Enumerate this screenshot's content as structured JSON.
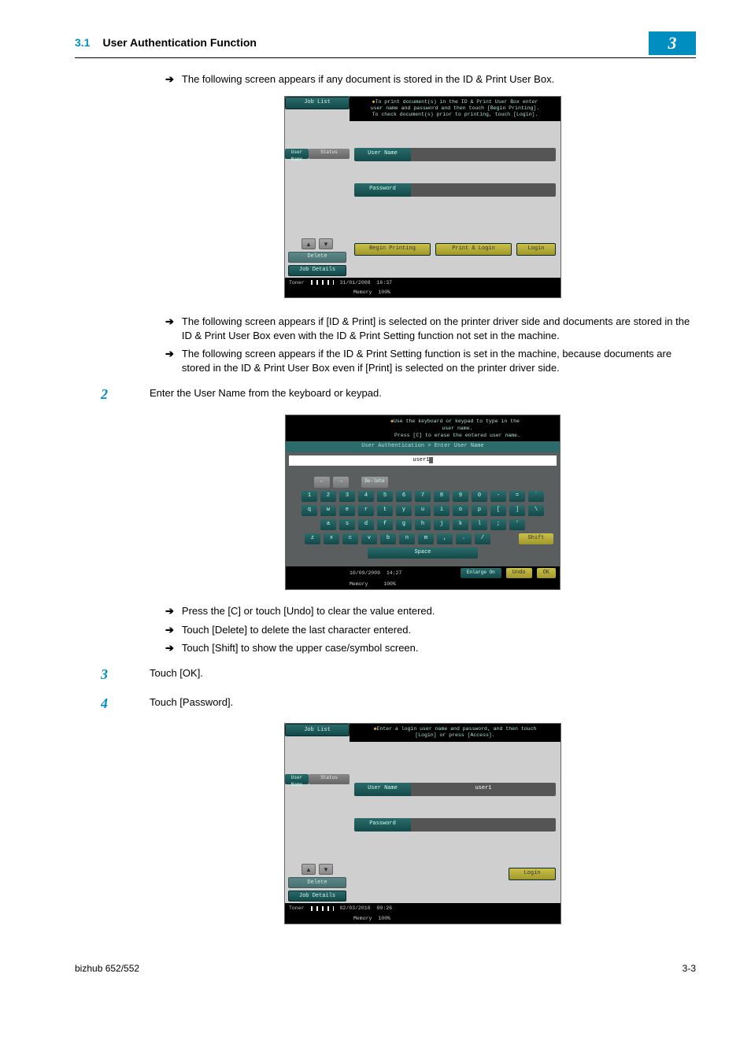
{
  "header": {
    "section_number": "3.1",
    "section_title": "User Authentication Function",
    "chapter_badge": "3"
  },
  "intro_arrow": "The following screen appears if any document is stored in the ID & Print User Box.",
  "shot1": {
    "job_list": "Job List",
    "hint1": "To print document(s) in the ID & Print User Box enter",
    "hint2": "user name and password and then touch [Begin Printing].",
    "hint3": "To check document(s) prior to printing, touch [Login].",
    "user_name_tab": "User Name",
    "status": "Status",
    "lab_user": "User Name",
    "lab_pass": "Password",
    "delete": "Delete",
    "job_details": "Job Details",
    "begin": "Begin Printing",
    "print_login": "Print & Login",
    "login": "Login",
    "toner": "Toner",
    "date": "31/01/2008",
    "time": "16:37",
    "memory": "Memory",
    "memval": "100%"
  },
  "after_shot1_b1": "The following screen appears if [ID & Print] is selected on the printer driver side and documents are stored in the ID & Print User Box even with the ID & Print Setting function not set in the machine.",
  "after_shot1_b2": "The following screen appears if the ID & Print Setting function is set in the machine, because documents are stored in the ID & Print User Box even if [Print] is selected on the printer driver side.",
  "step2": "Enter the User Name from the keyboard or keypad.",
  "shot2": {
    "hint1": "Use the keyboard or keypad to type in the",
    "hint2": "user name.",
    "hint3": "Press [C] to erase the entered user name.",
    "crumb": "User Authentication > Enter User Name",
    "input_val": "user1",
    "delete_key": "De-lete",
    "row_num": [
      "1",
      "2",
      "3",
      "4",
      "5",
      "6",
      "7",
      "8",
      "9",
      "0",
      "-",
      "=",
      "`"
    ],
    "row_q": [
      "q",
      "w",
      "e",
      "r",
      "t",
      "y",
      "u",
      "i",
      "o",
      "p",
      "[",
      "]",
      "\\"
    ],
    "row_a": [
      "a",
      "s",
      "d",
      "f",
      "g",
      "h",
      "j",
      "k",
      "l",
      ";",
      "'"
    ],
    "row_z": [
      "z",
      "x",
      "c",
      "v",
      "b",
      "n",
      "m",
      ",",
      ".",
      "/"
    ],
    "shift": "Shift",
    "space": "Space",
    "date": "10/09/2009",
    "time": "14:27",
    "memory": "Memory",
    "memval": "100%",
    "enlarge": "Enlarge On",
    "undo": "Undo",
    "ok": "OK"
  },
  "after_shot2_b1": "Press the [C] or touch [Undo] to clear the value entered.",
  "after_shot2_b2": "Touch [Delete] to delete the last character entered.",
  "after_shot2_b3": "Touch [Shift] to show the upper case/symbol screen.",
  "step3": "Touch [OK].",
  "step4": "Touch [Password].",
  "shot3": {
    "job_list": "Job List",
    "hint1": "Enter a login user name and password, and then touch",
    "hint2": "[Login] or press [Access].",
    "user_name_tab": "User Name",
    "status": "Status",
    "lab_user": "User Name",
    "val_user": "user1",
    "lab_pass": "Password",
    "delete": "Delete",
    "job_details": "Job Details",
    "login": "Login",
    "toner": "Toner",
    "date": "02/03/2010",
    "time": "09:26",
    "memory": "Memory",
    "memval": "100%"
  },
  "footer": {
    "left": "bizhub 652/552",
    "right": "3-3"
  }
}
